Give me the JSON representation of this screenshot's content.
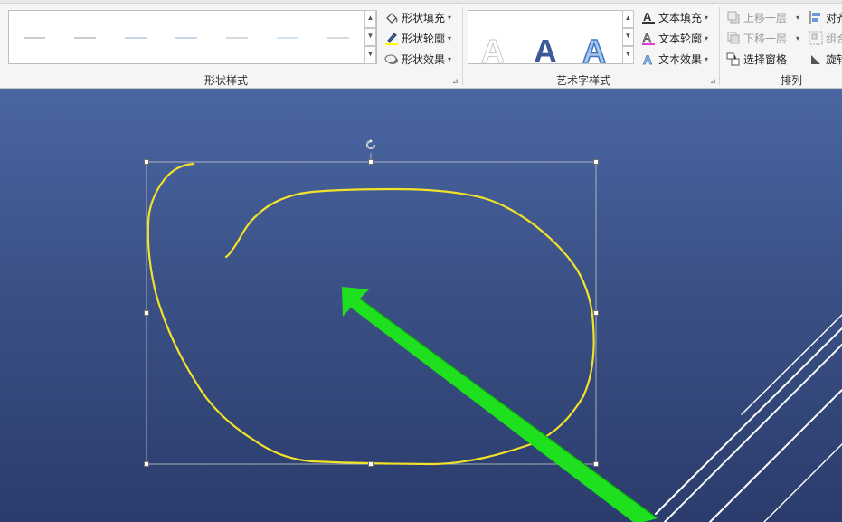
{
  "ribbon": {
    "shape_styles": {
      "fill_label": "形状填充",
      "outline_label": "形状轮廓",
      "effects_label": "形状效果",
      "group_label": "形状样式"
    },
    "wordart_styles": {
      "sample_letter": "A",
      "text_fill_label": "文本填充",
      "text_outline_label": "文本轮廓",
      "text_effects_label": "文本效果",
      "group_label": "艺术字样式"
    },
    "arrange": {
      "bring_forward_label": "上移一层",
      "send_backward_label": "下移一层",
      "selection_pane_label": "选择窗格",
      "align_label": "对齐",
      "group_label_btn": "组合",
      "rotate_label": "旋转",
      "group_label": "排列"
    }
  },
  "colors": {
    "scribble": "#f2e22a",
    "arrow": "#1ee01e",
    "outline_icon_bar": "#ffff00",
    "text_outline_icon_bar": "#e23ed6",
    "accent": "#3b5998"
  },
  "icons": {
    "fill": "paint-bucket-icon",
    "outline": "pen-icon",
    "effects": "shape-effects-icon",
    "rotate": "rotate-handle-icon"
  }
}
